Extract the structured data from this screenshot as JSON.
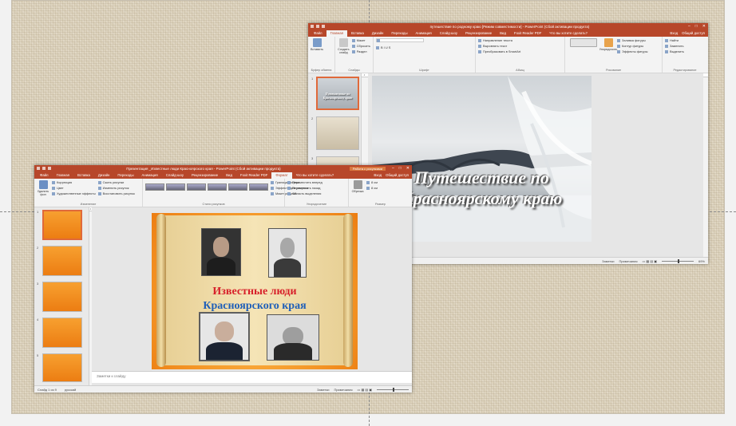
{
  "back_window": {
    "title": "путешествие по родному краю [Режим совместимости] - PowerPoint (Сбой активации продукта)",
    "tabs": [
      "Файл",
      "Главная",
      "Вставка",
      "Дизайн",
      "Переходы",
      "Анимация",
      "Слайд-шоу",
      "Рецензирование",
      "Вид",
      "Foxit Reader PDF"
    ],
    "tell_me": "Что вы хотите сделать?",
    "sign_in": "Вход",
    "share": "Общий доступ",
    "groups": {
      "clipboard": "Буфер обмена",
      "slides": "Слайды",
      "font": "Шрифт",
      "paragraph": "Абзац",
      "drawing": "Рисование",
      "editing": "Редактирование"
    },
    "buttons": {
      "paste": "Вставить",
      "new_slide": "Создать слайд",
      "layout": "Макет",
      "reset": "Сбросить",
      "section": "Раздел",
      "text_direction": "Направление текста",
      "align_text": "Выровнять текст",
      "smartart": "Преобразовать в SmartArt",
      "arrange": "Упорядочить",
      "quick_styles": "Экспресс-стили",
      "fill": "Заливка фигуры",
      "outline": "Контур фигуры",
      "effects": "Эффекты фигуры",
      "find": "Найти",
      "replace": "Заменить",
      "select": "Выделить"
    },
    "slide_title_line1": "Путешествие по",
    "slide_title_line2": "Красноярскому  краю",
    "thumb_caption": "Путешествие по Красноярскому краю",
    "status": {
      "notes": "Заметки",
      "comments": "Примечания",
      "zoom": "69%"
    }
  },
  "front_window": {
    "title": "Презентация _Известные люди Красноярского края   - PowerPoint (Сбой активации продукта)",
    "context_header": "Работа с рисунками",
    "tabs": [
      "Файл",
      "Главная",
      "Вставка",
      "Дизайн",
      "Переходы",
      "Анимация",
      "Слайд-шоу",
      "Рецензирование",
      "Вид",
      "Foxit Reader PDF",
      "Формат"
    ],
    "tell_me": "Что вы хотите сделать?",
    "sign_in": "Вход",
    "share": "Общий доступ",
    "groups": {
      "adjust": "Изменение",
      "picture_styles": "Стили рисунков",
      "arrange": "Упорядочение",
      "size": "Размер"
    },
    "buttons": {
      "remove_bg": "Удалить фон",
      "corrections": "Коррекция",
      "color": "Цвет",
      "artistic": "Художественные эффекты",
      "compress": "Сжать рисунки",
      "change_pic": "Изменить рисунок",
      "reset_pic": "Восстановить рисунок",
      "border": "Граница рисунка",
      "effects": "Эффекты для рисунка",
      "layout": "Макет рисунка",
      "bring_forward": "Переместить вперед",
      "send_backward": "Переместить назад",
      "selection_pane": "Область выделения",
      "crop": "Обрезка",
      "height": "8 см",
      "width": "8 см"
    },
    "slide_line1": "Известные люди",
    "slide_line2": "Красноярского края",
    "notes_placeholder": "Заметки к слайду",
    "status": {
      "slide_count": "Слайд 1 из 9",
      "language": "русский",
      "notes": "Заметки",
      "comments": "Примечания"
    },
    "thumb_numbers": [
      "1",
      "2",
      "3",
      "4",
      "5"
    ]
  }
}
